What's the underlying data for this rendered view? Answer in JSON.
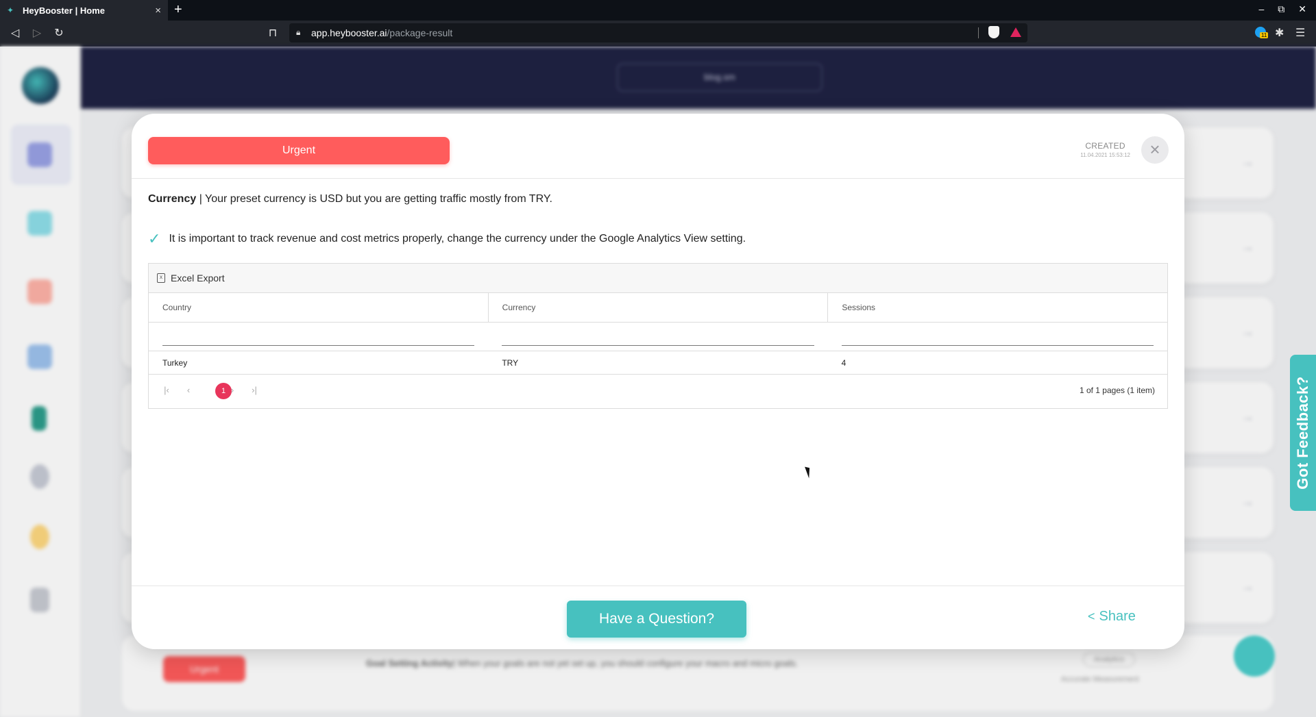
{
  "browser": {
    "tab_title": "HeyBooster | Home",
    "tab_close": "×",
    "new_tab": "+",
    "url_host": "app.heybooster.ai",
    "url_path": "/package-result",
    "window_controls": [
      "–",
      "⧉",
      "✕"
    ],
    "extension_badge": "11"
  },
  "background": {
    "domain_selector": "blog.sm",
    "sidebar_icons": [
      "home-icon",
      "cube-icon",
      "document-icon",
      "chart-icon",
      "bookmark-icon",
      "user-icon",
      "bell-icon",
      "share-arrow-icon"
    ],
    "bottom_row": {
      "badge": "Urgent",
      "title": "Goal Setting Activity",
      "text": "| When your goals are not yet set up, you should configure your macro and micro goals.",
      "tag": "Analytics",
      "category": "Accurate Measurement"
    }
  },
  "feedback": {
    "label": "Got Feedback?"
  },
  "modal": {
    "badge": "Urgent",
    "created_label": "CREATED",
    "created_date": "11.04.2021 15:53:12",
    "close_symbol": "×",
    "headline_bold": "Currency",
    "headline_rest": " | Your preset currency is USD but you are getting traffic mostly from TRY.",
    "tip": "It is important to track revenue and cost metrics properly, change the currency under the Google Analytics View setting.",
    "table": {
      "export_label": "Excel Export",
      "columns": [
        "Country",
        "Currency",
        "Sessions"
      ],
      "rows": [
        [
          "Turkey",
          "TRY",
          "4"
        ]
      ],
      "pager": {
        "current_page": "1",
        "info": "1 of 1 pages (1 item)"
      }
    },
    "footer": {
      "question_button": "Have a Question?",
      "share_button": "Share"
    }
  },
  "colors": {
    "urgent": "#ff5c5c",
    "accent": "#47c1bf",
    "page_active": "#e8355b",
    "topbar": "#1f2243"
  }
}
